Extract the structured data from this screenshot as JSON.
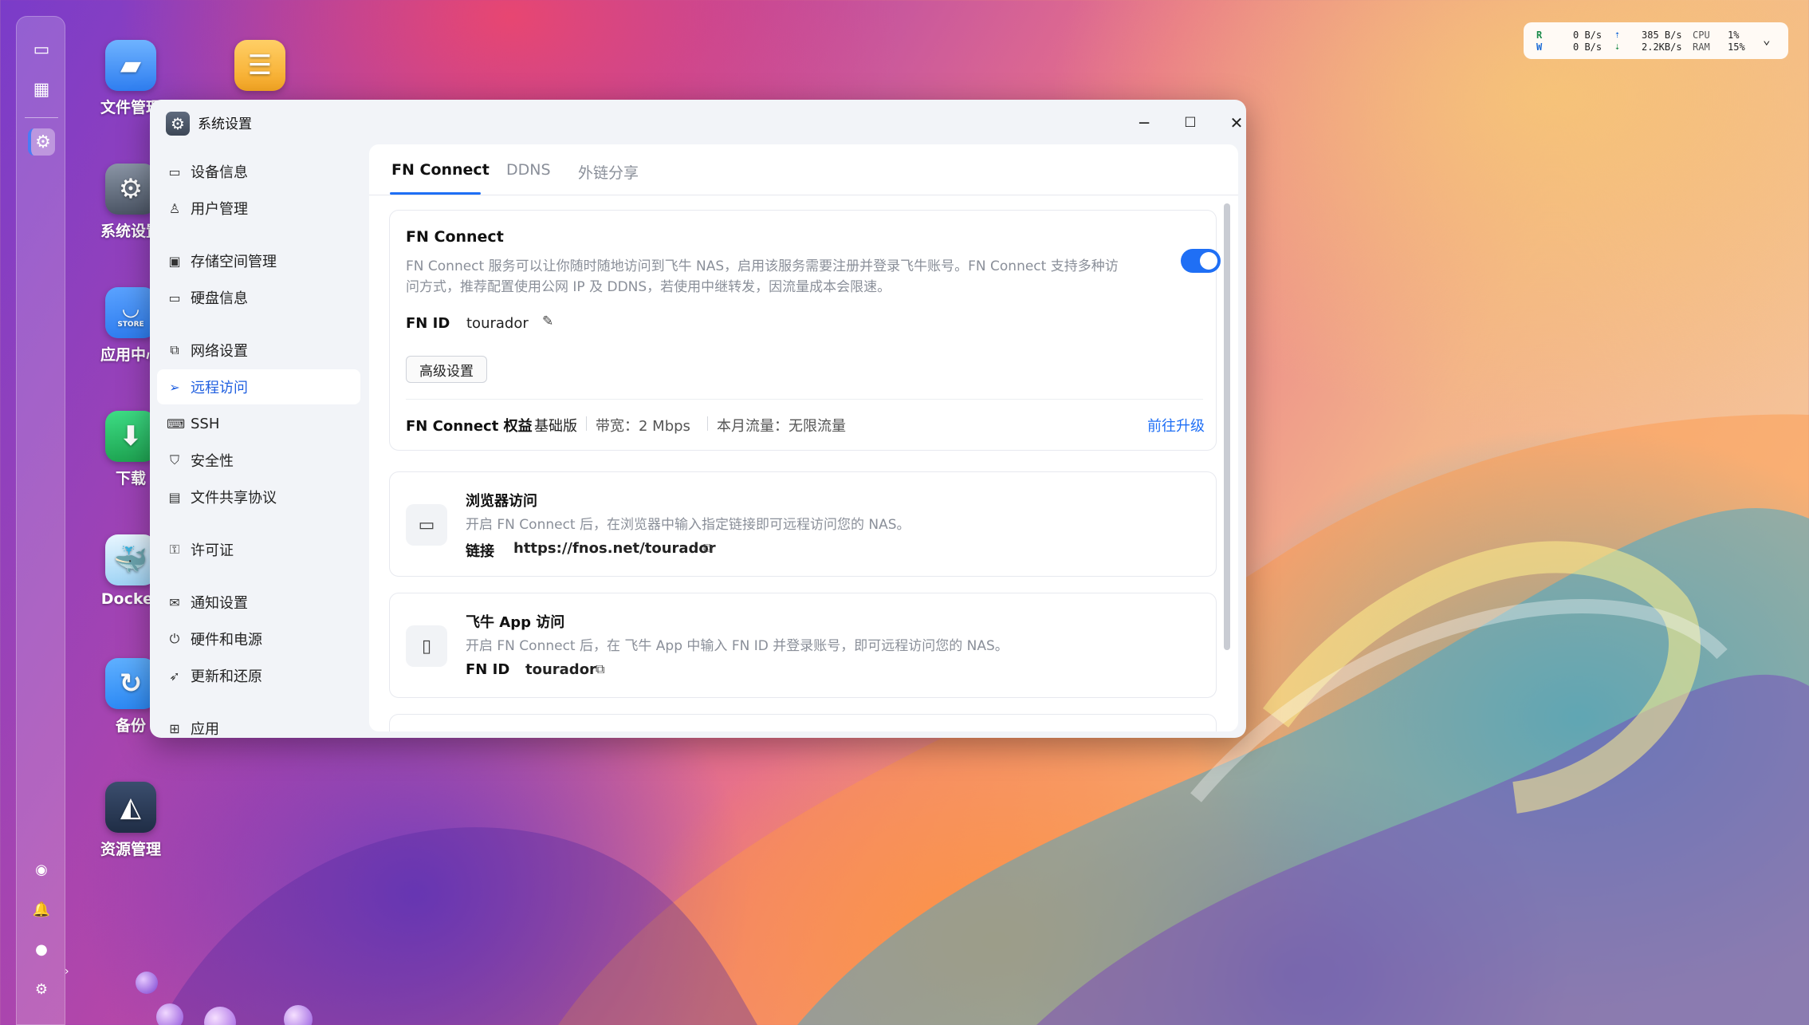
{
  "desktop": {
    "icons": [
      {
        "label": "文件管理",
        "icon": "folder-icon",
        "color": "#3d8cf5"
      },
      {
        "label": "系统设置",
        "icon": "gear-icon",
        "color": "#5d6878"
      },
      {
        "label": "应用中心",
        "icon": "store-icon",
        "color": "#2f7ef0",
        "badge": "STORE"
      },
      {
        "label": "下载",
        "icon": "download-icon",
        "color": "#2bbf6a"
      },
      {
        "label": "Docker",
        "icon": "docker-icon",
        "color": "#2b7cc8"
      },
      {
        "label": "备份",
        "icon": "backup-icon",
        "color": "#2d8af5"
      },
      {
        "label": "资源管理",
        "icon": "resource-monitor-icon",
        "color": "#2a3b55"
      }
    ],
    "notes_icon": "notes-icon"
  },
  "monitor": {
    "r_label": "R",
    "w_label": "W",
    "r_disk": "0  B/s",
    "w_disk": "0  B/s",
    "up": "385  B/s",
    "down": "2.2KB/s",
    "cpu_label": "CPU",
    "ram_label": "RAM",
    "cpu": "1%",
    "ram": "15%"
  },
  "window": {
    "title": "系统设置",
    "sidebar": [
      {
        "label": "设备信息",
        "icon": "device-icon"
      },
      {
        "label": "用户管理",
        "icon": "user-icon"
      },
      {
        "label": "存储空间管理",
        "icon": "storage-icon"
      },
      {
        "label": "硬盘信息",
        "icon": "disk-icon"
      },
      {
        "label": "网络设置",
        "icon": "network-icon"
      },
      {
        "label": "远程访问",
        "icon": "send-icon",
        "active": true
      },
      {
        "label": "SSH",
        "icon": "terminal-icon"
      },
      {
        "label": "安全性",
        "icon": "shield-icon"
      },
      {
        "label": "文件共享协议",
        "icon": "file-icon"
      },
      {
        "label": "许可证",
        "icon": "key-icon"
      },
      {
        "label": "通知设置",
        "icon": "mail-icon"
      },
      {
        "label": "硬件和电源",
        "icon": "power-icon"
      },
      {
        "label": "更新和还原",
        "icon": "rocket-icon"
      },
      {
        "label": "应用",
        "icon": "apps-icon"
      }
    ],
    "tabs": [
      "FN Connect",
      "DDNS",
      "外链分享"
    ],
    "fn_connect": {
      "title": "FN Connect",
      "desc_line1": "FN Connect 服务可以让你随时随地访问到飞牛 NAS，启用该服务需要注册并登录飞牛账号。FN Connect 支持多种访",
      "desc_line2": "问方式，推荐配置使用公网 IP 及 DDNS，若使用中继转发，因流量成本会限速。",
      "enabled": true,
      "fnid_label": "FN ID",
      "fnid_value": "tourador",
      "advanced_btn": "高级设置",
      "rights_label": "FN Connect 权益",
      "plan": "基础版",
      "bandwidth": "带宽：2 Mbps",
      "traffic": "本月流量：无限流量",
      "upgrade": "前往升级"
    },
    "browser_access": {
      "title": "浏览器访问",
      "desc": "开启 FN Connect 后，在浏览器中输入指定链接即可远程访问您的 NAS。",
      "link_label": "链接",
      "link": "https://fnos.net/tourador"
    },
    "app_access": {
      "title": "飞牛 App 访问",
      "desc": "开启 FN Connect 后，在 飞牛 App 中输入 FN ID 并登录账号，即可远程访问您的 NAS。",
      "fnid_label": "FN ID",
      "fnid_value": "tourador"
    }
  },
  "colors": {
    "accent": "#1f6ff5",
    "active_text": "#1f5fe0"
  }
}
